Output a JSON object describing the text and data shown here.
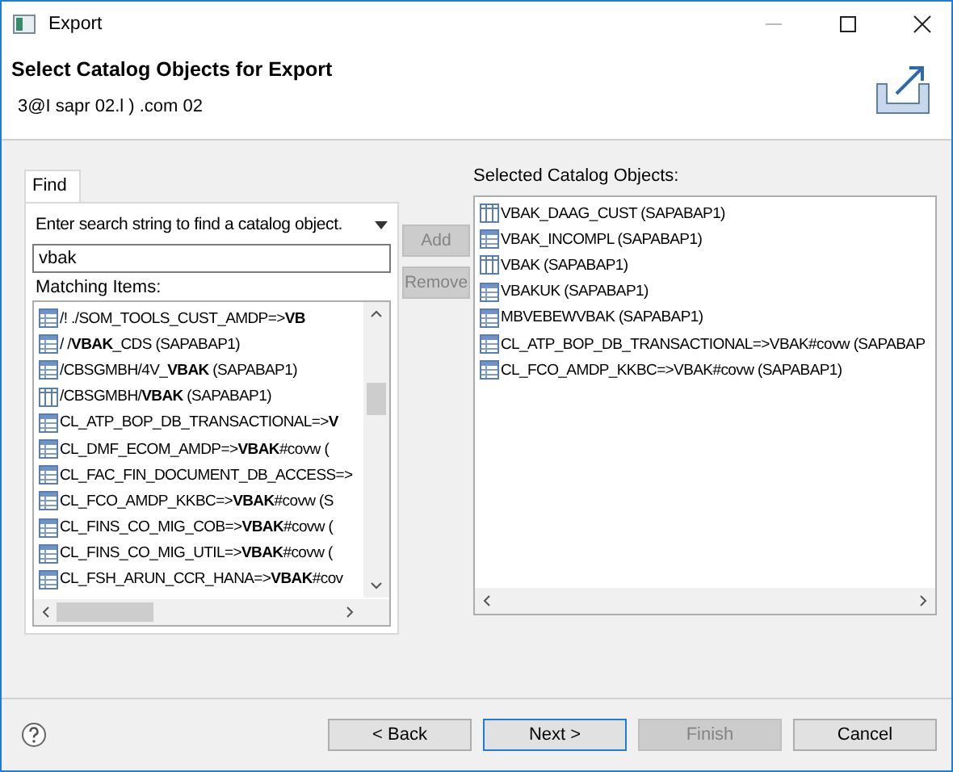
{
  "window": {
    "title": "Export"
  },
  "header": {
    "title": "Select Catalog Objects for Export",
    "subtitle": "3@I  sapr  02.l        )      .com 02"
  },
  "find_tab": {
    "label": "Find",
    "selected": true
  },
  "search": {
    "label": "Enter search string to find a catalog object.",
    "value": "vbak"
  },
  "matching": {
    "label": "Matching Items:",
    "items": [
      {
        "kind": "table",
        "text": "/!        ./SOM_TOOLS_CUST_AMDP=>**VB**"
      },
      {
        "kind": "table",
        "text": "/        /**VBAK**_CDS (SAPABAP1)"
      },
      {
        "kind": "table",
        "text": "/CBSGMBH/4V_**VBAK** (SAPABAP1)"
      },
      {
        "kind": "view",
        "text": "/CBSGMBH/**VBAK** (SAPABAP1)"
      },
      {
        "kind": "table",
        "text": "CL_ATP_BOP_DB_TRANSACTIONAL=>**V**"
      },
      {
        "kind": "table",
        "text": "CL_DMF_ECOM_AMDP=>**VBAK**#covw ("
      },
      {
        "kind": "table",
        "text": "CL_FAC_FIN_DOCUMENT_DB_ACCESS=>"
      },
      {
        "kind": "table",
        "text": "CL_FCO_AMDP_KKBC=>**VBAK**#covw (S"
      },
      {
        "kind": "table",
        "text": "CL_FINS_CO_MIG_COB=>**VBAK**#covw ("
      },
      {
        "kind": "table",
        "text": "CL_FINS_CO_MIG_UTIL=>**VBAK**#covw ("
      },
      {
        "kind": "table",
        "text": "CL_FSH_ARUN_CCR_HANA=>**VBAK**#cov"
      }
    ]
  },
  "add_button": {
    "label": "Add",
    "disabled": true
  },
  "remove_button": {
    "label": "Remove",
    "disabled": true
  },
  "selected": {
    "label": "Selected Catalog Objects:",
    "items": [
      {
        "kind": "view",
        "text": "VBAK_DAAG_CUST (SAPABAP1)"
      },
      {
        "kind": "table",
        "text": "VBAK_INCOMPL (SAPABAP1)"
      },
      {
        "kind": "view",
        "text": "VBAK (SAPABAP1)"
      },
      {
        "kind": "table",
        "text": "VBAKUK (SAPABAP1)"
      },
      {
        "kind": "table",
        "text": "MBVEBEWVBAK (SAPABAP1)"
      },
      {
        "kind": "table",
        "text": "CL_ATP_BOP_DB_TRANSACTIONAL=>VBAK#covw (SAPABAP"
      },
      {
        "kind": "table",
        "text": "CL_FCO_AMDP_KKBC=>VBAK#covw (SAPABAP1)"
      }
    ]
  },
  "buttons": [
    {
      "label": "< Back",
      "disabled": false,
      "default": false
    },
    {
      "label": "Next >",
      "disabled": false,
      "default": true
    },
    {
      "label": "Finish",
      "disabled": true,
      "default": false
    },
    {
      "label": "Cancel",
      "disabled": false,
      "default": false
    }
  ]
}
